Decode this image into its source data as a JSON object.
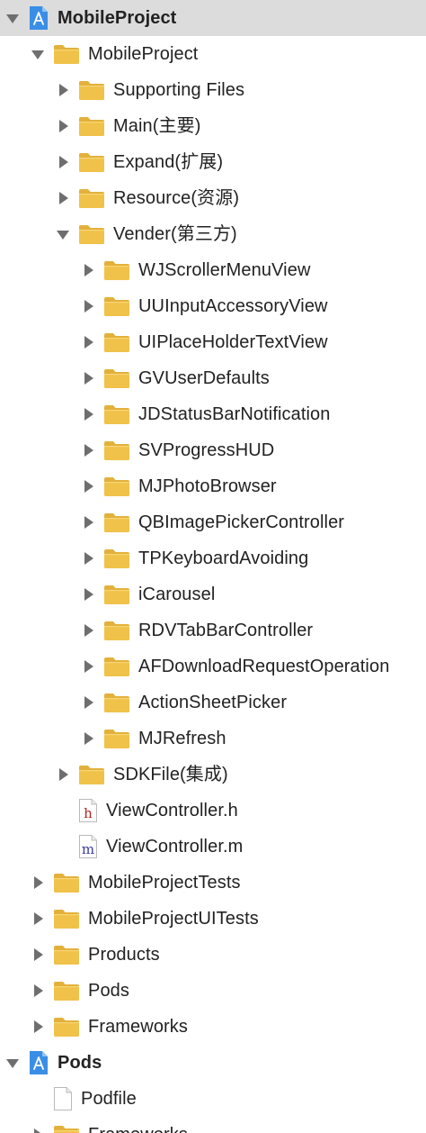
{
  "navigator": {
    "items": [
      {
        "label": "MobileProject",
        "kind": "project",
        "level": 0,
        "expanded": true,
        "selected": true
      },
      {
        "label": "MobileProject",
        "kind": "folder",
        "level": 1,
        "expanded": true
      },
      {
        "label": "Supporting Files",
        "kind": "folder",
        "level": 2,
        "expanded": false
      },
      {
        "label": "Main(主要)",
        "kind": "folder",
        "level": 2,
        "expanded": false
      },
      {
        "label": "Expand(扩展)",
        "kind": "folder",
        "level": 2,
        "expanded": false
      },
      {
        "label": "Resource(资源)",
        "kind": "folder",
        "level": 2,
        "expanded": false
      },
      {
        "label": "Vender(第三方)",
        "kind": "folder",
        "level": 2,
        "expanded": true
      },
      {
        "label": "WJScrollerMenuView",
        "kind": "folder",
        "level": 3,
        "expanded": false
      },
      {
        "label": "UUInputAccessoryView",
        "kind": "folder",
        "level": 3,
        "expanded": false
      },
      {
        "label": "UIPlaceHolderTextView",
        "kind": "folder",
        "level": 3,
        "expanded": false
      },
      {
        "label": "GVUserDefaults",
        "kind": "folder",
        "level": 3,
        "expanded": false
      },
      {
        "label": "JDStatusBarNotification",
        "kind": "folder",
        "level": 3,
        "expanded": false
      },
      {
        "label": "SVProgressHUD",
        "kind": "folder",
        "level": 3,
        "expanded": false
      },
      {
        "label": "MJPhotoBrowser",
        "kind": "folder",
        "level": 3,
        "expanded": false
      },
      {
        "label": "QBImagePickerController",
        "kind": "folder",
        "level": 3,
        "expanded": false
      },
      {
        "label": "TPKeyboardAvoiding",
        "kind": "folder",
        "level": 3,
        "expanded": false
      },
      {
        "label": "iCarousel",
        "kind": "folder",
        "level": 3,
        "expanded": false
      },
      {
        "label": "RDVTabBarController",
        "kind": "folder",
        "level": 3,
        "expanded": false
      },
      {
        "label": "AFDownloadRequestOperation",
        "kind": "folder",
        "level": 3,
        "expanded": false
      },
      {
        "label": "ActionSheetPicker",
        "kind": "folder",
        "level": 3,
        "expanded": false
      },
      {
        "label": "MJRefresh",
        "kind": "folder",
        "level": 3,
        "expanded": false
      },
      {
        "label": "SDKFile(集成)",
        "kind": "folder",
        "level": 2,
        "expanded": false
      },
      {
        "label": "ViewController.h",
        "kind": "file-h",
        "level": 2
      },
      {
        "label": "ViewController.m",
        "kind": "file-m",
        "level": 2
      },
      {
        "label": "MobileProjectTests",
        "kind": "folder",
        "level": 1,
        "expanded": false
      },
      {
        "label": "MobileProjectUITests",
        "kind": "folder",
        "level": 1,
        "expanded": false
      },
      {
        "label": "Products",
        "kind": "folder",
        "level": 1,
        "expanded": false
      },
      {
        "label": "Pods",
        "kind": "folder",
        "level": 1,
        "expanded": false
      },
      {
        "label": "Frameworks",
        "kind": "folder",
        "level": 1,
        "expanded": false
      },
      {
        "label": "Pods",
        "kind": "project",
        "level": 0,
        "expanded": true
      },
      {
        "label": "Podfile",
        "kind": "file-plain",
        "level": 1
      },
      {
        "label": "Frameworks",
        "kind": "folder",
        "level": 1,
        "expanded": false
      }
    ]
  },
  "colors": {
    "selection": "#dcdcdc",
    "folder": "#f0c24a",
    "folder_tab": "#e3b13b",
    "project_icon": "#3a8ee6",
    "disclosure": "#6e6e6e",
    "h_letter": "#b3261e",
    "m_letter": "#3b3aa3"
  }
}
